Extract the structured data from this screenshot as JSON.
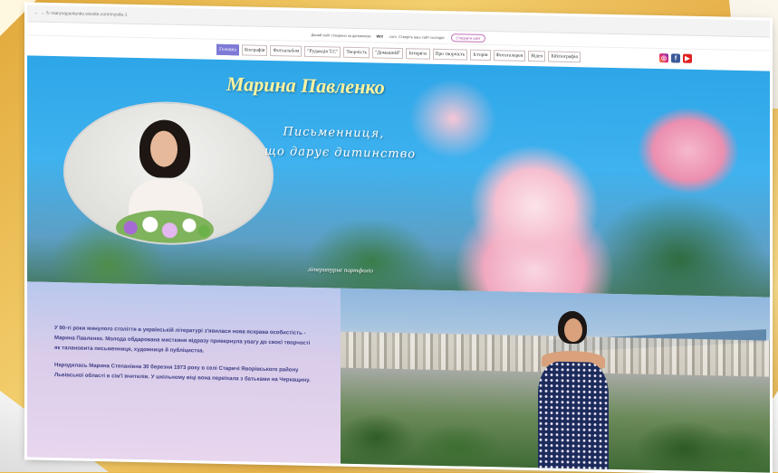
{
  "browser": {
    "url": "← →  ↻   marynapavlenko.wixsite.com/mysite-1"
  },
  "wix_banner": {
    "text_before": "Даний сайт створено за допомогою",
    "brand": "WIX",
    "text_after": ".com. Створіть ваш сайт сьогодні.",
    "button": "Створити сайт"
  },
  "nav": [
    "Головна",
    "Біографія",
    "Фотоальбом",
    "\"Рудакція Т.С\"",
    "Творчість",
    "\"Домашній\"",
    "Інтерв'ю",
    "Про творчість",
    "Історія",
    "Фотогалерея",
    "Відео",
    "Бібліографія"
  ],
  "hero": {
    "title": "Марина Павленко",
    "subtitle": "    Письменниця,\nщо дарує дитинство",
    "portfolio": "літературне портфоліо"
  },
  "about": {
    "p1": "У 90-ті роки минулого століття в українській літературі з'явилася нова яскрава особистість - Марина Павленко. Молода обдарована мисткиня відразу привернула увагу до своєї творчості як талановита письменниця, художниця й публіцистка.",
    "p2": "Народилась Марина Степанівна 30 березня 1973 року в селі Старичі Яворівського району Львівської області в сім'ї вчителів. У шкільному віці вона переїхала з батьками на Черкащину."
  },
  "social": {
    "instagram": "◎",
    "facebook": "f",
    "youtube": "▶"
  },
  "colors": {
    "accent_nav": "#7d7bd6",
    "title_yellow": "#fff4a0",
    "text_purple": "#3f3f86"
  }
}
